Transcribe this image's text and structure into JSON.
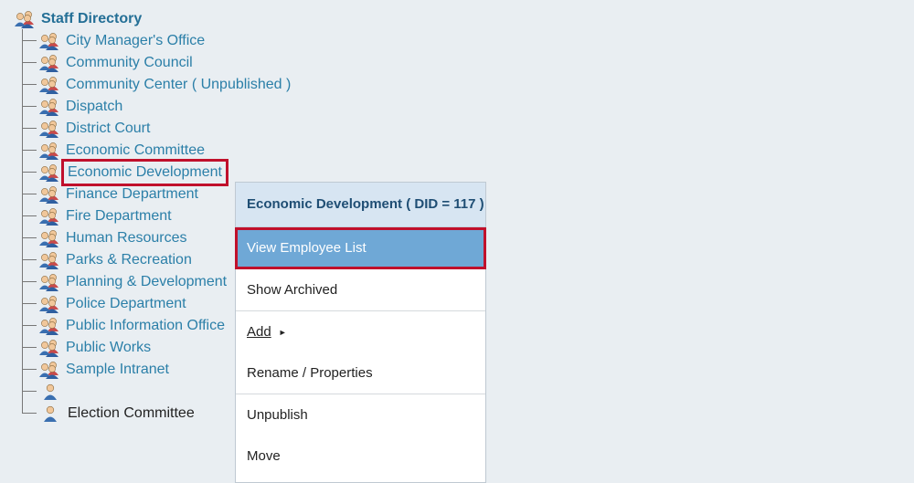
{
  "tree": {
    "root_label": "Staff Directory",
    "items": [
      {
        "label": "City Manager's Office"
      },
      {
        "label": "Community Council"
      },
      {
        "label": "Community Center ( Unpublished )"
      },
      {
        "label": "Dispatch"
      },
      {
        "label": "District Court"
      },
      {
        "label": "Economic Committee"
      },
      {
        "label": "Economic Development"
      },
      {
        "label": "Finance Department"
      },
      {
        "label": "Fire Department"
      },
      {
        "label": "Human Resources"
      },
      {
        "label": "Parks & Recreation"
      },
      {
        "label": "Planning & Development"
      },
      {
        "label": "Police Department"
      },
      {
        "label": "Public Information Office"
      },
      {
        "label": "Public Works"
      },
      {
        "label": "Sample Intranet"
      }
    ],
    "last_label": "Election Committee"
  },
  "context_menu": {
    "header": "Economic Development ( DID = 117 )",
    "view_employee_list": "View Employee List",
    "show_archived": "Show Archived",
    "add": "Add",
    "add_arrow": "►",
    "rename_properties": "Rename / Properties",
    "unpublish": "Unpublish",
    "move": "Move"
  },
  "colors": {
    "link": "#2b7fa8",
    "active_bg": "#6fa8d6",
    "highlight": "#c0102c",
    "header_bg": "#d7e5f2"
  }
}
